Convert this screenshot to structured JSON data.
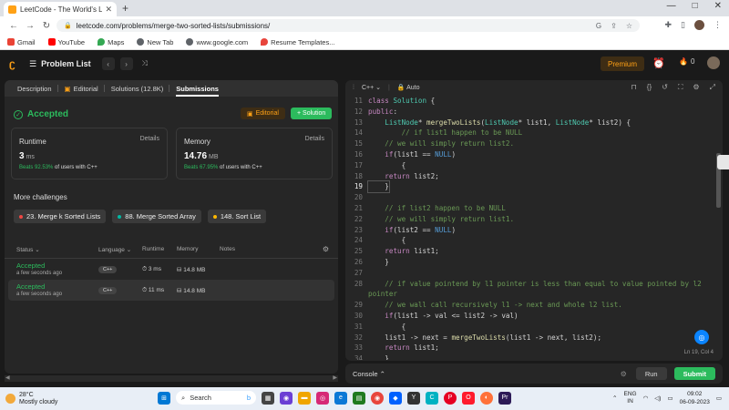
{
  "browser": {
    "tab_title": "LeetCode - The World's Leading",
    "new_tab": "+",
    "url": "leetcode.com/problems/merge-two-sorted-lists/submissions/",
    "window_controls": [
      "—",
      "□",
      "✕"
    ],
    "bookmarks": [
      {
        "label": "Gmail",
        "color": "#ea4335"
      },
      {
        "label": "YouTube",
        "color": "#ff0000"
      },
      {
        "label": "Maps",
        "color": "#34a853"
      },
      {
        "label": "New Tab",
        "color": "#5f6368"
      },
      {
        "label": "www.google.com",
        "color": "#5f6368"
      },
      {
        "label": "Resume Templates...",
        "color": "#e8453c"
      }
    ]
  },
  "nav": {
    "problem_list": "Problem List",
    "premium": "Premium",
    "streak": "0"
  },
  "tabs": [
    "Description",
    "Editorial",
    "Solutions (12.8K)",
    "Submissions"
  ],
  "result": {
    "status": "Accepted",
    "editorial_btn": "Editorial",
    "solution_btn": "+ Solution",
    "runtime": {
      "label": "Runtime",
      "details": "Details",
      "value": "3",
      "unit": "ms",
      "beats_pct": "Beats 92.53%",
      "beats_rest": "of users with C++"
    },
    "memory": {
      "label": "Memory",
      "details": "Details",
      "value": "14.76",
      "unit": "MB",
      "beats_pct": "Beats 67.95%",
      "beats_rest": "of users with C++"
    }
  },
  "more_challenges": {
    "title": "More challenges",
    "items": [
      {
        "label": "23. Merge k Sorted Lists",
        "color": "#ef4743"
      },
      {
        "label": "88. Merge Sorted Array",
        "color": "#00b8a3"
      },
      {
        "label": "148. Sort List",
        "color": "#ffb800"
      }
    ]
  },
  "submissions": {
    "headers": [
      "Status",
      "Language",
      "Runtime",
      "Memory",
      "Notes"
    ],
    "rows": [
      {
        "status": "Accepted",
        "time": "a few seconds ago",
        "lang": "C++",
        "runtime": "3 ms",
        "memory": "14.8 MB"
      },
      {
        "status": "Accepted",
        "time": "a few seconds ago",
        "lang": "C++",
        "runtime": "11 ms",
        "memory": "14.8 MB"
      }
    ]
  },
  "editor": {
    "language": "C++",
    "mode": "Auto",
    "cursor": "Ln 19, Col 4",
    "current_line": 19,
    "lines": [
      {
        "n": "11",
        "t": [
          [
            "kw",
            "class "
          ],
          [
            "ty",
            "Solution"
          ],
          [
            "pl",
            " {"
          ]
        ]
      },
      {
        "n": "12",
        "t": [
          [
            "kw",
            "public"
          ],
          [
            "pl",
            ":"
          ]
        ]
      },
      {
        "n": "13",
        "t": [
          [
            "pl",
            "    "
          ],
          [
            "ty",
            "ListNode"
          ],
          [
            "pl",
            "* "
          ],
          [
            "fn",
            "mergeTwoLists"
          ],
          [
            "pl",
            "("
          ],
          [
            "ty",
            "ListNode"
          ],
          [
            "pl",
            "* list1, "
          ],
          [
            "ty",
            "ListNode"
          ],
          [
            "pl",
            "* list2) {"
          ]
        ]
      },
      {
        "n": "14",
        "t": [
          [
            "cm",
            "        // if list1 happen to be NULL"
          ]
        ]
      },
      {
        "n": "15",
        "t": [
          [
            "cm",
            "    // we will simply return list2."
          ]
        ]
      },
      {
        "n": "16",
        "t": [
          [
            "pl",
            "    "
          ],
          [
            "kw",
            "if"
          ],
          [
            "pl",
            "(list1 == "
          ],
          [
            "nl",
            "NULL"
          ],
          [
            "pl",
            ")"
          ]
        ]
      },
      {
        "n": "17",
        "t": [
          [
            "pl",
            "        {"
          ]
        ]
      },
      {
        "n": "18",
        "t": [
          [
            "pl",
            "    "
          ],
          [
            "kw",
            "return"
          ],
          [
            "pl",
            " list2;"
          ]
        ]
      },
      {
        "n": "19",
        "t": [
          [
            "pl",
            "    }"
          ]
        ]
      },
      {
        "n": "20",
        "t": [
          [
            "pl",
            ""
          ]
        ]
      },
      {
        "n": "21",
        "t": [
          [
            "cm",
            "    // if list2 happen to be NULL"
          ]
        ]
      },
      {
        "n": "22",
        "t": [
          [
            "cm",
            "    // we will simply return list1."
          ]
        ]
      },
      {
        "n": "23",
        "t": [
          [
            "pl",
            "    "
          ],
          [
            "kw",
            "if"
          ],
          [
            "pl",
            "(list2 == "
          ],
          [
            "nl",
            "NULL"
          ],
          [
            "pl",
            ")"
          ]
        ]
      },
      {
        "n": "24",
        "t": [
          [
            "pl",
            "        {"
          ]
        ]
      },
      {
        "n": "25",
        "t": [
          [
            "pl",
            "    "
          ],
          [
            "kw",
            "return"
          ],
          [
            "pl",
            " list1;"
          ]
        ]
      },
      {
        "n": "26",
        "t": [
          [
            "pl",
            "    }"
          ]
        ]
      },
      {
        "n": "27",
        "t": [
          [
            "pl",
            ""
          ]
        ]
      },
      {
        "n": "28",
        "t": [
          [
            "cm",
            "    // if value pointend by l1 pointer is less than equal to value pointed by l2"
          ]
        ]
      },
      {
        "n": "",
        "t": [
          [
            "cm",
            "pointer"
          ]
        ]
      },
      {
        "n": "29",
        "t": [
          [
            "cm",
            "    // we wall call recursively l1 -> next and whole l2 list."
          ]
        ]
      },
      {
        "n": "30",
        "t": [
          [
            "pl",
            "    "
          ],
          [
            "kw",
            "if"
          ],
          [
            "pl",
            "(list1 -> val <= list2 -> val)"
          ]
        ]
      },
      {
        "n": "31",
        "t": [
          [
            "pl",
            "        {"
          ]
        ]
      },
      {
        "n": "32",
        "t": [
          [
            "pl",
            "    list1 -> next = "
          ],
          [
            "fn",
            "mergeTwoLists"
          ],
          [
            "pl",
            "(list1 -> next, list2);"
          ]
        ]
      },
      {
        "n": "33",
        "t": [
          [
            "pl",
            "    "
          ],
          [
            "kw",
            "return"
          ],
          [
            "pl",
            " list1;"
          ]
        ]
      },
      {
        "n": "34",
        "t": [
          [
            "pl",
            "    }"
          ]
        ]
      }
    ]
  },
  "console": {
    "label": "Console",
    "run": "Run",
    "submit": "Submit"
  },
  "taskbar": {
    "temp": "28°C",
    "weather": "Mostly cloudy",
    "search": "Search",
    "lang1": "ENG",
    "lang2": "IN",
    "time": "09:02",
    "date": "06-09-2023"
  }
}
